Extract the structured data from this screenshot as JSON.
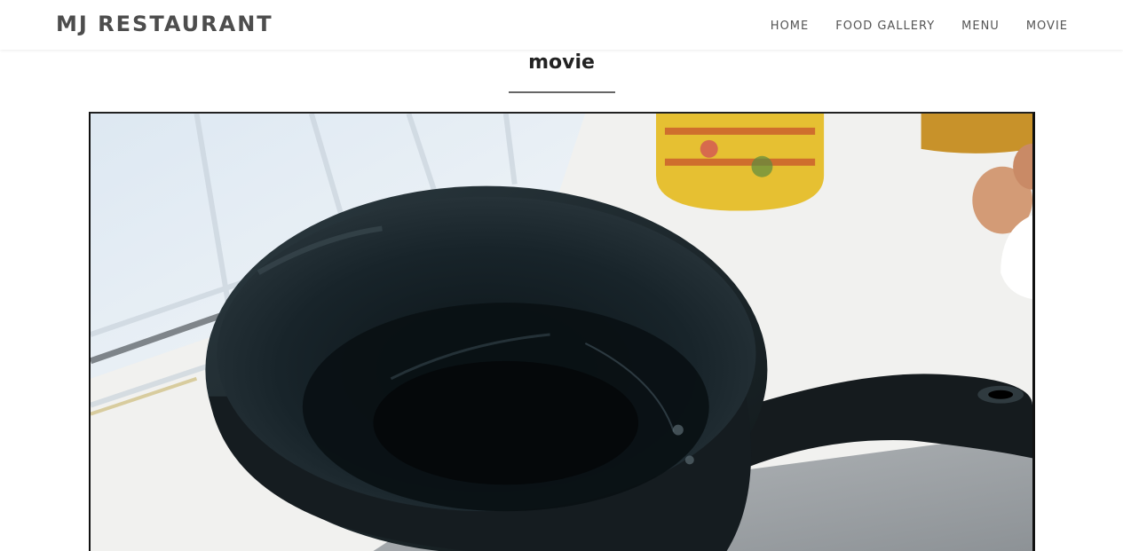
{
  "navbar": {
    "brand": "MJ RESTAURANT",
    "items": [
      "HOME",
      "FOOD GALLERY",
      "MENU",
      "MOVIE"
    ]
  },
  "section": {
    "title": "movie"
  },
  "video": {
    "icon": "video-player",
    "subject": "black frying pan on gas stove"
  },
  "colors": {
    "brand_text": "#4d4d4d",
    "nav_text": "#555555",
    "title_rule": "#666666",
    "background": "#ffffff"
  }
}
